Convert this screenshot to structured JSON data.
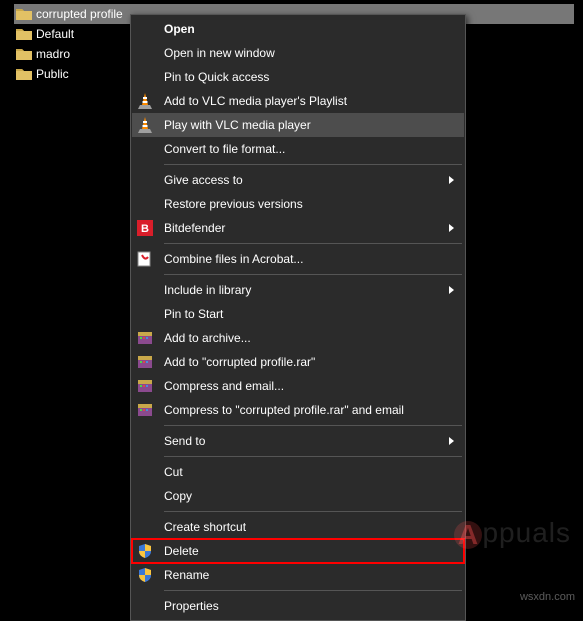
{
  "files": [
    {
      "name": "corrupted profile",
      "selected": true
    },
    {
      "name": "Default",
      "selected": false
    },
    {
      "name": "madro",
      "selected": false
    },
    {
      "name": "Public",
      "selected": false
    }
  ],
  "menu": {
    "open": "Open",
    "open_new_window": "Open in new window",
    "pin_quick_access": "Pin to Quick access",
    "vlc_playlist": "Add to VLC media player's Playlist",
    "vlc_play": "Play with VLC media player",
    "convert_file_format": "Convert to file format...",
    "give_access_to": "Give access to",
    "restore_previous": "Restore previous versions",
    "bitdefender": "Bitdefender",
    "combine_acrobat": "Combine files in Acrobat...",
    "include_library": "Include in library",
    "pin_start": "Pin to Start",
    "add_archive": "Add to archive...",
    "add_rar": "Add to \"corrupted profile.rar\"",
    "compress_email": "Compress and email...",
    "compress_rar_email": "Compress to \"corrupted profile.rar\" and email",
    "send_to": "Send to",
    "cut": "Cut",
    "copy": "Copy",
    "create_shortcut": "Create shortcut",
    "delete": "Delete",
    "rename": "Rename",
    "properties": "Properties"
  },
  "watermark": {
    "text": "ppuals"
  },
  "footer": {
    "text": "wsxdn.com"
  }
}
